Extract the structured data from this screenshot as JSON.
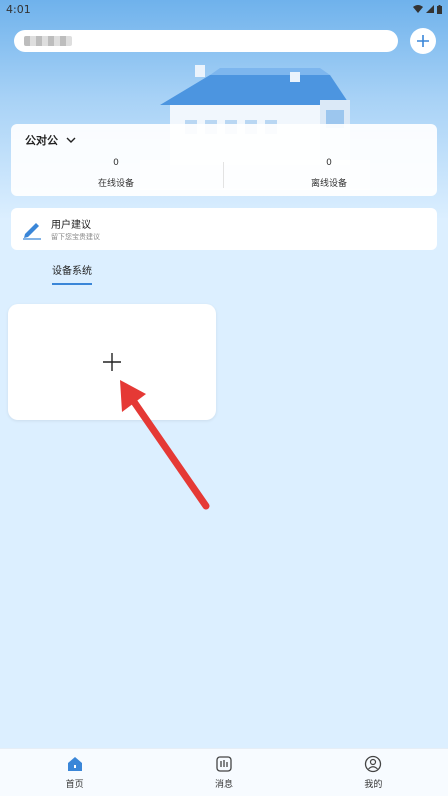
{
  "status_bar": {
    "time": "4:01"
  },
  "home": {
    "name": "公对公"
  },
  "stats": {
    "online": {
      "value": "0",
      "label": "在线设备"
    },
    "offline": {
      "value": "0",
      "label": "离线设备"
    }
  },
  "feedback": {
    "title": "用户建议",
    "subtitle": "留下您宝贵建议"
  },
  "tabs": [
    {
      "label": "设备系统"
    }
  ],
  "nav": [
    {
      "label": "首页",
      "icon": "home-icon"
    },
    {
      "label": "消息",
      "icon": "message-icon"
    },
    {
      "label": "我的",
      "icon": "profile-icon"
    }
  ],
  "colors": {
    "accent": "#3a86d8",
    "arrow": "#e53935",
    "background": "#dcefff"
  }
}
